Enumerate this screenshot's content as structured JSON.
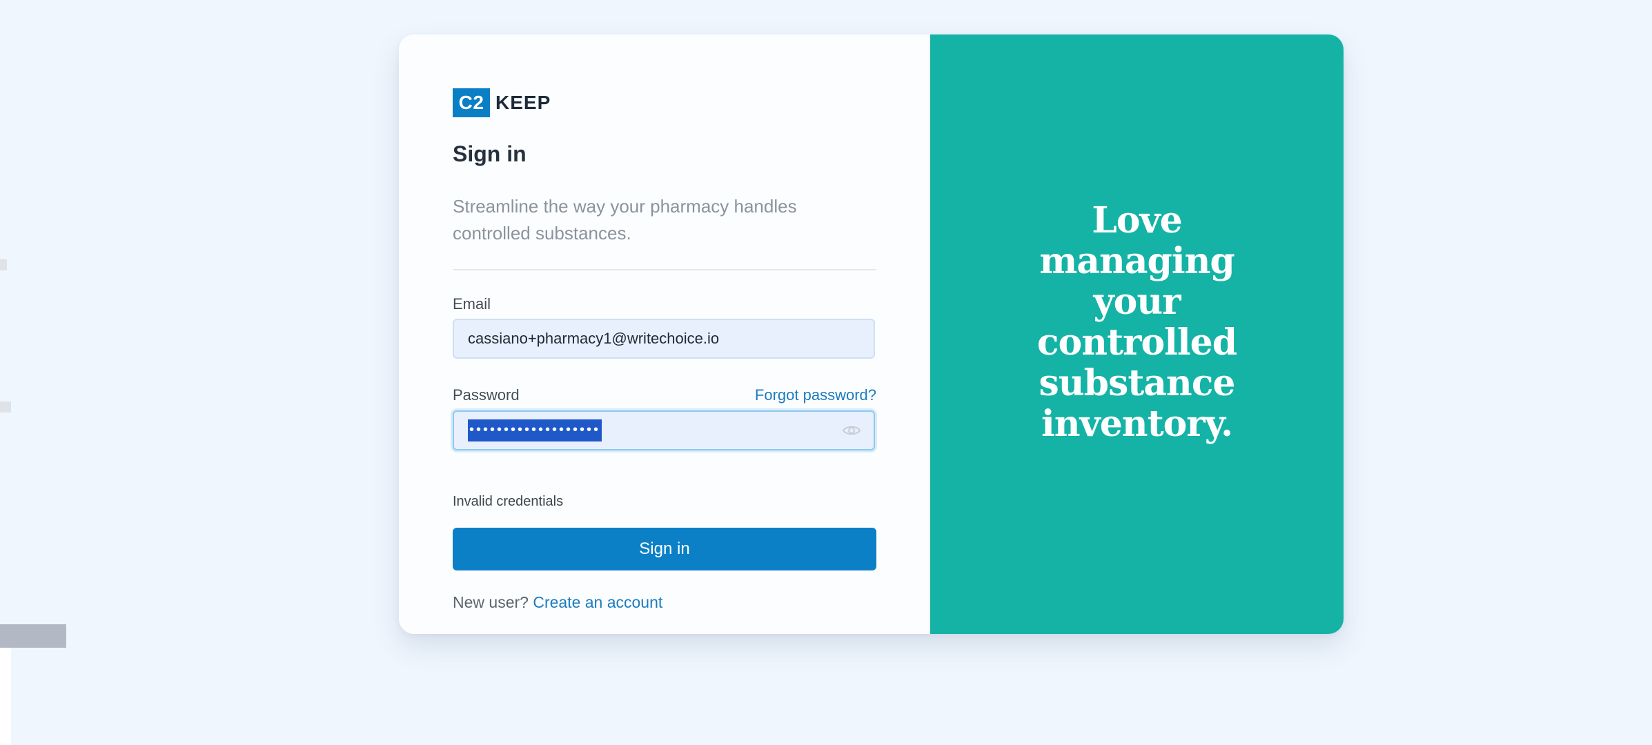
{
  "logo": {
    "mark": "C2",
    "text": "KEEP"
  },
  "form": {
    "title": "Sign in",
    "subtitle": "Streamline the way your pharmacy handles controlled substances.",
    "email_label": "Email",
    "email_value": "cassiano+pharmacy1@writechoice.io",
    "password_label": "Password",
    "forgot_link": "Forgot password?",
    "password_masked": "•••••••••••••••••••",
    "error_message": "Invalid credentials",
    "submit_label": "Sign in",
    "new_user_prompt": "New user?",
    "create_account_link": "Create an account"
  },
  "promo": {
    "tagline": "Love managing your controlled substance inventory."
  },
  "colors": {
    "brand_blue": "#0b80c7",
    "teal_panel": "#14b3a5",
    "selection": "#1f58c8"
  },
  "icons": {
    "password_toggle": "eye-icon"
  }
}
